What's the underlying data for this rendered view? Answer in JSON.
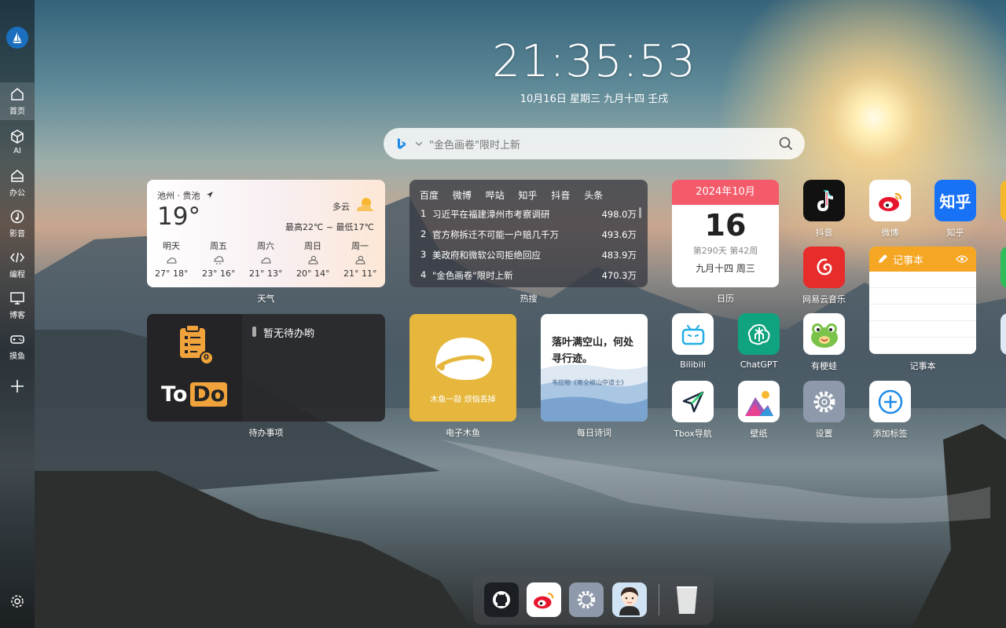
{
  "sidebar": {
    "items": [
      {
        "label": "首页",
        "icon": "home-icon"
      },
      {
        "label": "AI",
        "icon": "cube-icon"
      },
      {
        "label": "办公",
        "icon": "briefcase-icon"
      },
      {
        "label": "影音",
        "icon": "music-icon"
      },
      {
        "label": "编程",
        "icon": "code-icon"
      },
      {
        "label": "博客",
        "icon": "monitor-icon"
      },
      {
        "label": "摸鱼",
        "icon": "gamepad-icon"
      }
    ]
  },
  "clock": {
    "time": "21:35:53",
    "date": "10月16日  星期三  九月十四  壬戌"
  },
  "search": {
    "placeholder": "\"金色画卷\"限时上新"
  },
  "weather": {
    "location": "池州 · 贵池",
    "temp": "19°",
    "condition": "多云",
    "range": "最高22℃ ~ 最低17℃",
    "days": [
      {
        "day": "明天",
        "temp": "27° 18°"
      },
      {
        "day": "周五",
        "temp": "23° 16°"
      },
      {
        "day": "周六",
        "temp": "21° 13°"
      },
      {
        "day": "周日",
        "temp": "20° 14°"
      },
      {
        "day": "周一",
        "temp": "21° 11°"
      }
    ],
    "label": "天气"
  },
  "hot": {
    "tabs": [
      "百度",
      "微博",
      "哔站",
      "知乎",
      "抖音",
      "头条"
    ],
    "items": [
      {
        "rank": "1",
        "title": "习近平在福建漳州市考察调研",
        "count": "498.0万"
      },
      {
        "rank": "2",
        "title": "官方称拆迁不可能一户赔几千万",
        "count": "493.6万"
      },
      {
        "rank": "3",
        "title": "美政府和微软公司拒绝回应",
        "count": "483.9万"
      },
      {
        "rank": "4",
        "title": "\"金色画卷\"限时上新",
        "count": "470.3万"
      }
    ],
    "label": "热搜"
  },
  "calendar": {
    "month": "2024年10月",
    "day": "16",
    "info": "第290天 第42周",
    "lunar": "九月十四 周三",
    "label": "日历"
  },
  "apps": {
    "douyin": "抖音",
    "weibo": "微博",
    "zhihu": "知乎",
    "zhihu_text": "知乎",
    "netease": "网易云音乐",
    "bilibili": "Bilibili",
    "chatgpt": "ChatGPT",
    "frog": "有梗蛙",
    "tbox": "Tbox导航",
    "wallpaper": "壁纸",
    "settings": "设置",
    "add": "添加标签"
  },
  "notepad": {
    "title": "记事本",
    "label": "记事本"
  },
  "todo": {
    "empty": "暂无待办哟",
    "logo_a": "To",
    "logo_b": "Do",
    "badge": "0",
    "label": "待办事项"
  },
  "muyu": {
    "caption": "木鱼一敲 烦恼丢掉",
    "label": "电子木鱼"
  },
  "poem": {
    "text": "落叶满空山，何处寻行迹。",
    "source": "韦应物《寄全椒山中道士》",
    "label": "每日诗词"
  },
  "colors": {
    "accent": "#1a6fbf",
    "calendar": "#f35a6a",
    "notepad": "#f5a623"
  }
}
